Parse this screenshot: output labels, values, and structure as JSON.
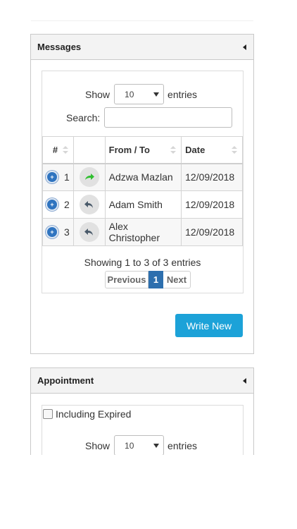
{
  "messages_panel": {
    "title": "Messages",
    "show_label": "Show",
    "entries_label": "entries",
    "page_length": "10",
    "search_label": "Search:",
    "search_value": "",
    "columns": [
      "#",
      "",
      "From / To",
      "Date"
    ],
    "rows": [
      {
        "num": "1",
        "action_icon": "forward-icon",
        "action_color": "#2fbf2f",
        "from_to": "Adzwa Mazlan",
        "date": "12/09/2018"
      },
      {
        "num": "2",
        "action_icon": "reply-icon",
        "action_color": "#4a5a6a",
        "from_to": "Adam Smith",
        "date": "12/09/2018"
      },
      {
        "num": "3",
        "action_icon": "reply-icon",
        "action_color": "#4a5a6a",
        "from_to": "Alex Christopher",
        "date": "12/09/2018"
      }
    ],
    "info": "Showing 1 to 3 of 3 entries",
    "pagination": {
      "previous": "Previous",
      "current": "1",
      "next": "Next"
    },
    "write_new": "Write New"
  },
  "appointment_panel": {
    "title": "Appointment",
    "including_expired": "Including Expired",
    "show_label": "Show",
    "entries_label": "entries",
    "page_length": "10"
  },
  "colors": {
    "accent": "#1ca2d8",
    "page_active": "#2d6fae",
    "expand": "#2f74c0"
  }
}
